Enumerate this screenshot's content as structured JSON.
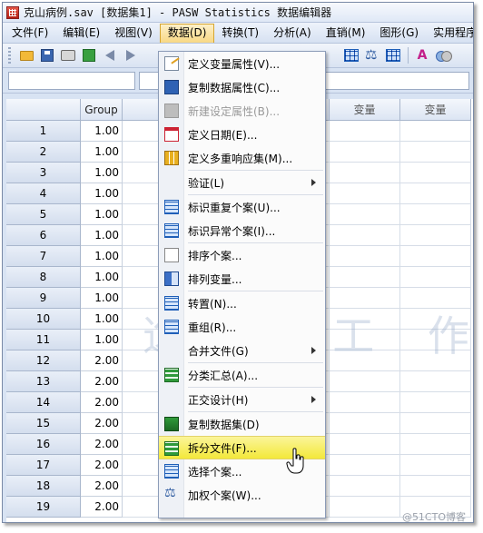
{
  "window": {
    "title": "克山病例.sav [数据集1] - PASW Statistics 数据编辑器"
  },
  "menubar": {
    "items": [
      {
        "label": "文件(F)",
        "active": false
      },
      {
        "label": "编辑(E)",
        "active": false
      },
      {
        "label": "视图(V)",
        "active": false
      },
      {
        "label": "数据(D)",
        "active": true
      },
      {
        "label": "转换(T)",
        "active": false
      },
      {
        "label": "分析(A)",
        "active": false
      },
      {
        "label": "直销(M)",
        "active": false
      },
      {
        "label": "图形(G)",
        "active": false
      },
      {
        "label": "实用程序(U)",
        "active": false
      }
    ]
  },
  "grid": {
    "columns": [
      "Group",
      "",
      "变量",
      "变量"
    ],
    "rows": [
      {
        "num": "1",
        "group": "1.00"
      },
      {
        "num": "2",
        "group": "1.00"
      },
      {
        "num": "3",
        "group": "1.00"
      },
      {
        "num": "4",
        "group": "1.00"
      },
      {
        "num": "5",
        "group": "1.00"
      },
      {
        "num": "6",
        "group": "1.00"
      },
      {
        "num": "7",
        "group": "1.00"
      },
      {
        "num": "8",
        "group": "1.00"
      },
      {
        "num": "9",
        "group": "1.00"
      },
      {
        "num": "10",
        "group": "1.00"
      },
      {
        "num": "11",
        "group": "1.00"
      },
      {
        "num": "12",
        "group": "2.00"
      },
      {
        "num": "13",
        "group": "2.00"
      },
      {
        "num": "14",
        "group": "2.00"
      },
      {
        "num": "15",
        "group": "2.00"
      },
      {
        "num": "16",
        "group": "2.00"
      },
      {
        "num": "17",
        "group": "2.00"
      },
      {
        "num": "18",
        "group": "2.00"
      },
      {
        "num": "19",
        "group": "2.00"
      }
    ]
  },
  "data_menu": {
    "items": [
      {
        "label": "定义变量属性(V)...",
        "icon": "define-properties-icon",
        "disabled": false
      },
      {
        "label": "复制数据属性(C)...",
        "icon": "copy-properties-icon",
        "disabled": false
      },
      {
        "label": "新建设定属性(B)...",
        "icon": "new-attribute-icon",
        "disabled": true
      },
      {
        "label": "定义日期(E)...",
        "icon": "calendar-icon",
        "disabled": false
      },
      {
        "label": "定义多重响应集(M)...",
        "icon": "multiple-response-icon",
        "disabled": false
      },
      {
        "label": "验证(L)",
        "icon": "",
        "submenu": true
      },
      {
        "label": "标识重复个案(U)...",
        "icon": "duplicate-cases-icon",
        "disabled": false
      },
      {
        "label": "标识异常个案(I)...",
        "icon": "unusual-cases-icon",
        "disabled": false
      },
      {
        "label": "排序个案...",
        "icon": "sort-cases-icon",
        "disabled": false
      },
      {
        "label": "排列变量...",
        "icon": "sort-variables-icon",
        "disabled": false
      },
      {
        "label": "转置(N)...",
        "icon": "transpose-icon",
        "disabled": false
      },
      {
        "label": "重组(R)...",
        "icon": "restructure-icon",
        "disabled": false
      },
      {
        "label": "合并文件(G)",
        "icon": "",
        "submenu": true
      },
      {
        "label": "分类汇总(A)...",
        "icon": "aggregate-icon",
        "disabled": false
      },
      {
        "label": "正交设计(H)",
        "icon": "",
        "submenu": true
      },
      {
        "label": "复制数据集(D)",
        "icon": "copy-dataset-icon",
        "disabled": false
      },
      {
        "label": "拆分文件(F)...",
        "icon": "split-file-icon",
        "disabled": false,
        "highlighted": true
      },
      {
        "label": "选择个案...",
        "icon": "select-cases-icon",
        "disabled": false
      },
      {
        "label": "加权个案(W)...",
        "icon": "weight-cases-icon",
        "disabled": false
      }
    ]
  },
  "watermark": "逸 飞 工 作 室",
  "credit": "@51CTO博客"
}
